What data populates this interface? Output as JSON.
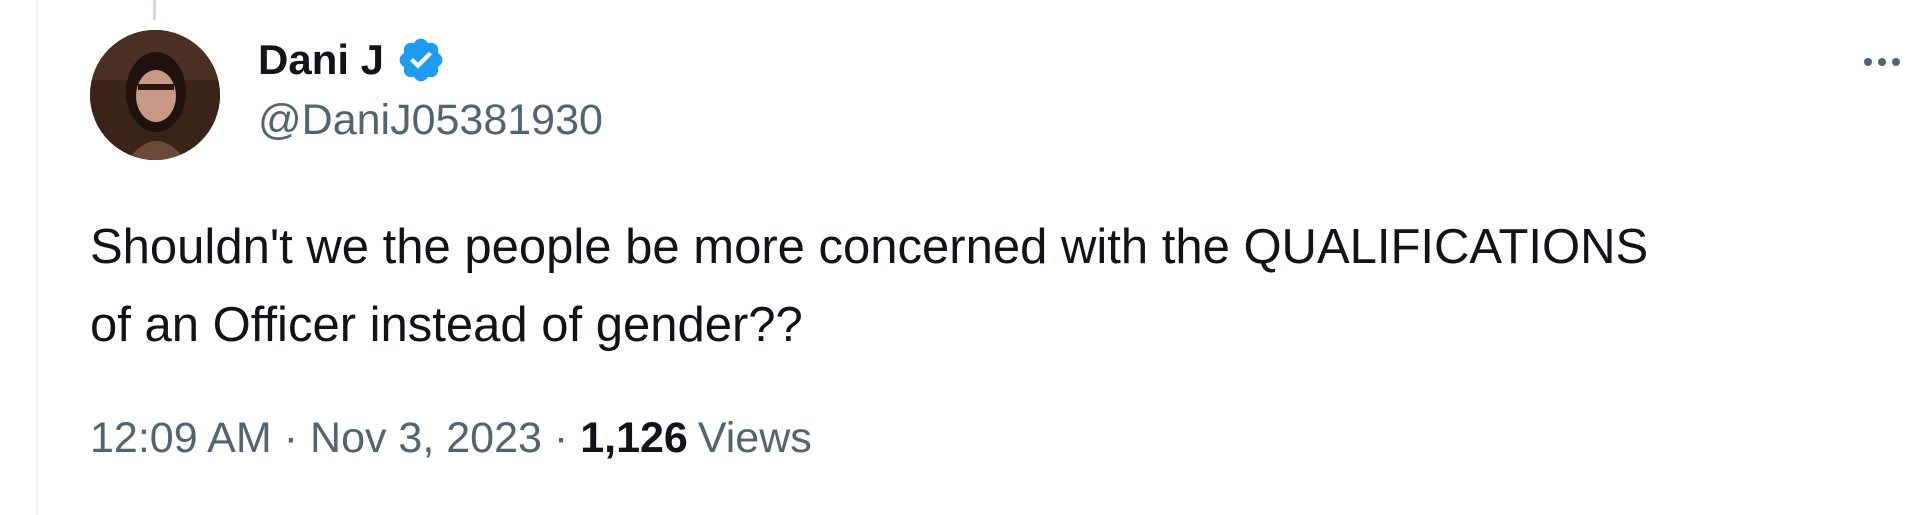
{
  "tweet": {
    "author": {
      "display_name": "Dani J",
      "handle": "@DaniJ05381930",
      "verified": true,
      "avatar_icon": "profile-photo"
    },
    "text_line1": "Shouldn't we the people be more concerned with the QUALIFICATIONS",
    "text_line2": "of an Officer instead of gender??",
    "time": "12:09 AM",
    "date": "Nov 3, 2023",
    "separator": "·",
    "view_count": "1,126",
    "views_label": "Views"
  },
  "icons": {
    "verified": "verified-badge-icon",
    "more": "more-options-icon"
  },
  "colors": {
    "text_primary": "#0f1419",
    "text_secondary": "#536471",
    "verified_blue": "#1d9bf0",
    "divider": "#eff3f4"
  }
}
